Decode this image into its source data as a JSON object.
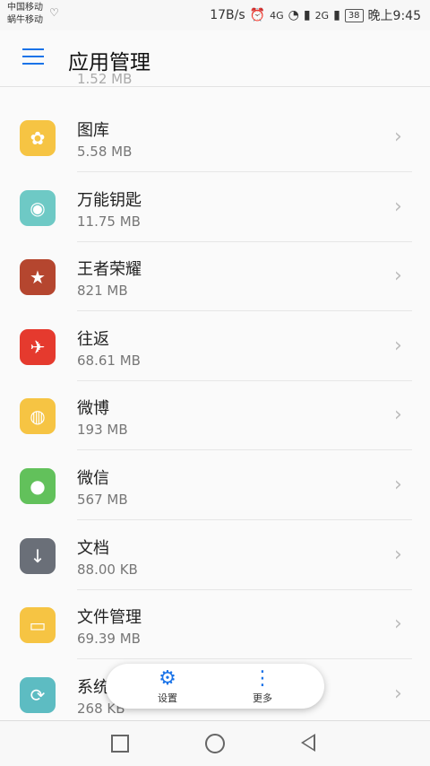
{
  "status_bar": {
    "carrier1": "中国移动",
    "carrier2": "蜗牛移动",
    "speed": "17B/s",
    "sig1": "4G",
    "sig2": "2G",
    "battery": "38",
    "time": "晚上9:45"
  },
  "header": {
    "title": "应用管理"
  },
  "list": {
    "partial_size": "1.52 MB",
    "items": [
      {
        "name": "图库",
        "size": "5.58 MB",
        "color": "#f6c443",
        "icon": "flower-icon"
      },
      {
        "name": "万能钥匙",
        "size": "11.75 MB",
        "color": "#6ec9c5",
        "icon": "wifi-key-icon"
      },
      {
        "name": "王者荣耀",
        "size": "821 MB",
        "color": "#b5462f",
        "icon": "game-hero-icon"
      },
      {
        "name": "往返",
        "size": "68.61 MB",
        "color": "#e53a2e",
        "icon": "bird-icon"
      },
      {
        "name": "微博",
        "size": "193 MB",
        "color": "#f6c443",
        "icon": "weibo-icon"
      },
      {
        "name": "微信",
        "size": "567 MB",
        "color": "#62c15b",
        "icon": "chat-bubble-icon"
      },
      {
        "name": "文档",
        "size": "88.00 KB",
        "color": "#6a6f78",
        "icon": "download-icon"
      },
      {
        "name": "文件管理",
        "size": "69.39 MB",
        "color": "#f6c443",
        "icon": "folder-icon"
      },
      {
        "name": "系统更新",
        "size": "268 KB",
        "color": "#5dbcc2",
        "icon": "refresh-icon"
      }
    ]
  },
  "popup": {
    "settings_label": "设置",
    "more_label": "更多"
  }
}
